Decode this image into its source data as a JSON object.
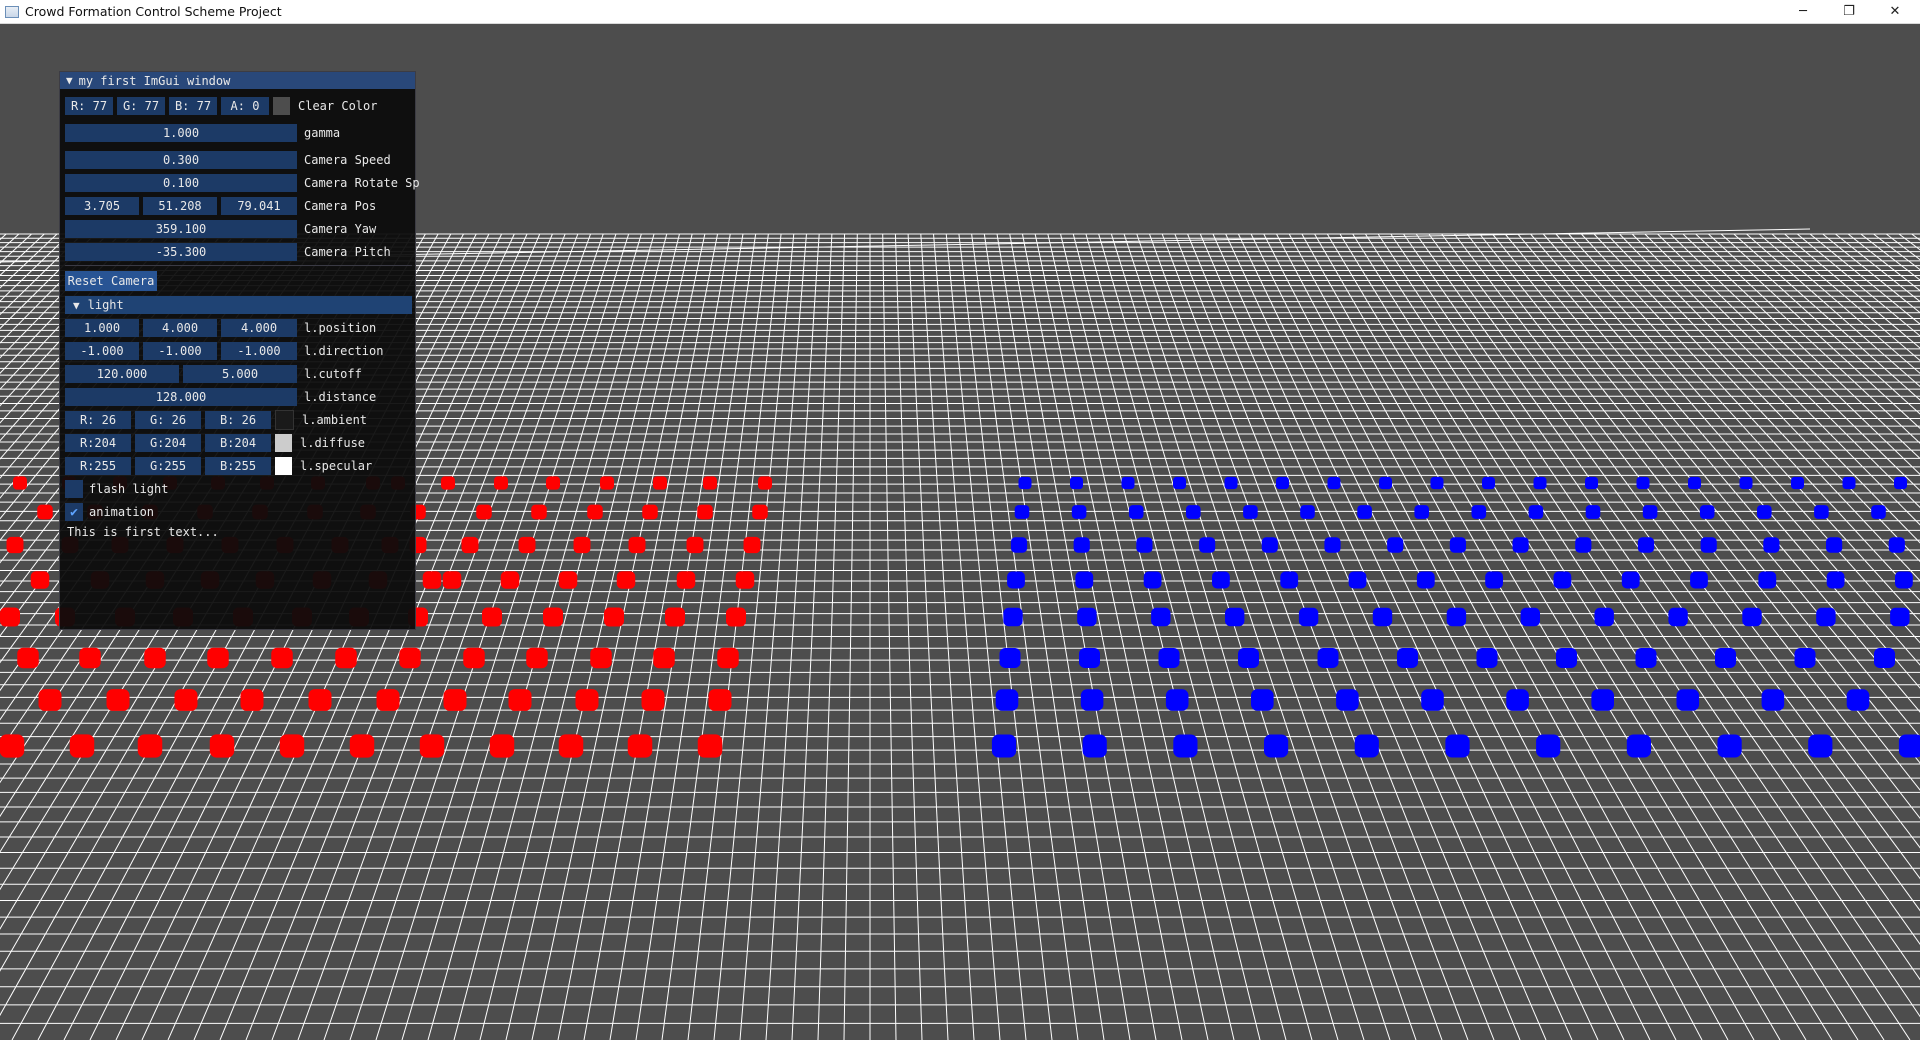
{
  "window": {
    "title": "Crowd Formation Control Scheme Project",
    "minimize_glyph": "─",
    "restore_glyph": "❐",
    "close_glyph": "✕"
  },
  "imgui": {
    "title": "my first ImGui window",
    "clear_color": {
      "r": "R: 77",
      "g": "G: 77",
      "b": "B: 77",
      "a": "A:  0",
      "label": "Clear Color",
      "swatch": "#4d4d4d"
    },
    "gamma": {
      "value": "1.000",
      "label": "gamma"
    },
    "camera_speed": {
      "value": "0.300",
      "label": "Camera Speed"
    },
    "camera_rotate": {
      "value": "0.100",
      "label": "Camera Rotate Sp"
    },
    "camera_pos": {
      "x": "3.705",
      "y": "51.208",
      "z": "79.041",
      "label": "Camera Pos"
    },
    "camera_yaw": {
      "value": "359.100",
      "label": "Camera Yaw"
    },
    "camera_pitch": {
      "value": "-35.300",
      "label": "Camera Pitch"
    },
    "reset_camera": "Reset Camera",
    "light": {
      "header": "light",
      "position": {
        "x": "1.000",
        "y": "4.000",
        "z": "4.000",
        "label": "l.position"
      },
      "direction": {
        "x": "-1.000",
        "y": "-1.000",
        "z": "-1.000",
        "label": "l.direction"
      },
      "cutoff": {
        "a": "120.000",
        "b": "5.000",
        "label": "l.cutoff"
      },
      "distance": {
        "value": "128.000",
        "label": "l.distance"
      },
      "ambient": {
        "r": "R: 26",
        "g": "G: 26",
        "b": "B: 26",
        "label": "l.ambient",
        "swatch": "#1a1a1a"
      },
      "diffuse": {
        "r": "R:204",
        "g": "G:204",
        "b": "B:204",
        "label": "l.diffuse",
        "swatch": "#cccccc"
      },
      "specular": {
        "r": "R:255",
        "g": "G:255",
        "b": "B:255",
        "label": "l.specular",
        "swatch": "#ffffff"
      }
    },
    "flash_light": {
      "label": "flash light",
      "checked": false
    },
    "animation": {
      "label": "animation",
      "checked": true,
      "check_glyph": "✔"
    },
    "text": "This is first text..."
  },
  "scene": {
    "background": "#4d4d4d",
    "grid_color": "#ffffff",
    "red_crowd_color": "#ff0000",
    "blue_crowd_color": "#0000ff"
  }
}
